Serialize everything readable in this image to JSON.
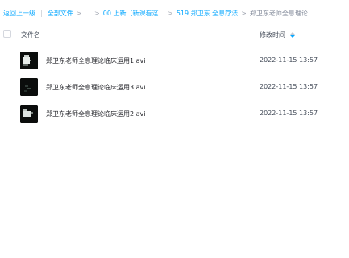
{
  "breadcrumb": {
    "back": "返回上一级",
    "all_files": "全部文件",
    "ellipsis": "...",
    "folder1": "00.上新（新课看这...",
    "folder2": "519.郑卫东 全息疗法",
    "current": "郑卫东老师全息理论..."
  },
  "columns": {
    "name": "文件名",
    "modified": "修改时间"
  },
  "files": [
    {
      "name": "郑卫东老师全息理论临床运用1.avi",
      "modified": "2022-11-15 13:57"
    },
    {
      "name": "郑卫东老师全息理论临床运用3.avi",
      "modified": "2022-11-15 13:57"
    },
    {
      "name": "郑卫东老师全息理论临床运用2.avi",
      "modified": "2022-11-15 13:57"
    }
  ],
  "colors": {
    "accent": "#06a7ff",
    "thumbnail_bg": "#0b0d0c"
  }
}
